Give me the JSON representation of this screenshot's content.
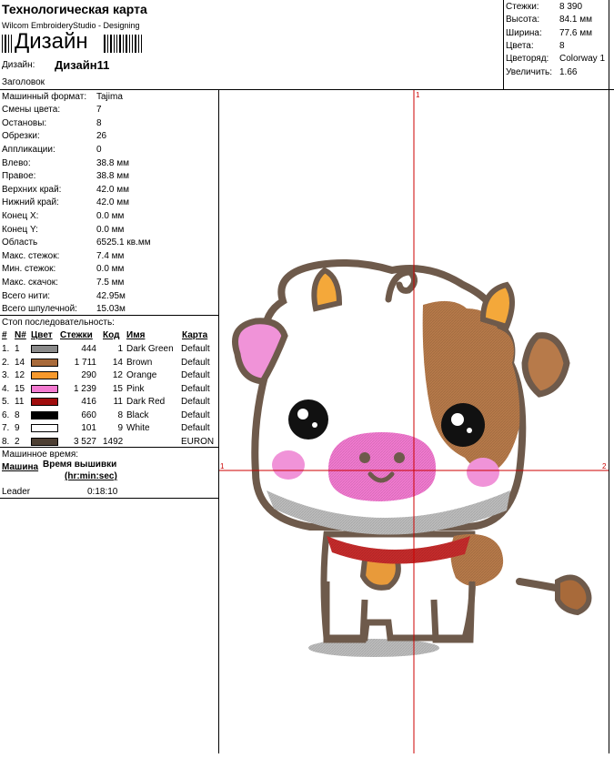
{
  "header": {
    "title": "Технологическая карта",
    "subtitle": "Wilcom EmbroideryStudio - Designing",
    "barcode_text": "Дизайн",
    "design_label": "Дизайн:",
    "design_name": "Дизайн11",
    "heading_label": "Заголовок"
  },
  "summary": [
    {
      "label": "Стежки:",
      "value": "8 390"
    },
    {
      "label": "Высота:",
      "value": "84.1 мм"
    },
    {
      "label": "Ширина:",
      "value": "77.6 мм"
    },
    {
      "label": "Цвета:",
      "value": "8"
    },
    {
      "label": "Цветоряд:",
      "value": "Colorway 1"
    },
    {
      "label": "Увеличить:",
      "value": "1.66"
    }
  ],
  "machine_info": [
    {
      "label": "Машинный формат:",
      "value": "Tajima"
    },
    {
      "label": "Смены цвета:",
      "value": "7"
    },
    {
      "label": "Остановы:",
      "value": "8"
    },
    {
      "label": "Обрезки:",
      "value": "26"
    },
    {
      "label": "Аппликации:",
      "value": "0"
    },
    {
      "label": "Влево:",
      "value": "38.8 мм"
    },
    {
      "label": "Правое:",
      "value": "38.8 мм"
    },
    {
      "label": "Верхних край:",
      "value": "42.0 мм"
    },
    {
      "label": "Нижний край:",
      "value": "42.0 мм"
    },
    {
      "label": "Конец X:",
      "value": "0.0 мм"
    },
    {
      "label": "Конец Y:",
      "value": "0.0 мм"
    },
    {
      "label": "Область",
      "value": "6525.1 кв.мм"
    },
    {
      "label": "Макс. стежок:",
      "value": "7.4 мм"
    },
    {
      "label": "Мин. стежок:",
      "value": "0.0 мм"
    },
    {
      "label": "Макс. скачок:",
      "value": "7.5 мм"
    },
    {
      "label": "Всего нити:",
      "value": "42.95м"
    },
    {
      "label": "Всего шпулечной:",
      "value": "15.03м"
    }
  ],
  "sequence": {
    "title": "Стоп последовательность:",
    "headers": {
      "num": "#",
      "n": "N#",
      "color": "Цвет",
      "stitches": "Стежки",
      "code": "Код",
      "name": "Имя",
      "chart": "Карта"
    },
    "rows": [
      {
        "num": "1.",
        "n": "1",
        "color": "#8a8a8a",
        "stitches": "444",
        "code": "1",
        "name": "Dark Green",
        "chart": "Default"
      },
      {
        "num": "2.",
        "n": "14",
        "color": "#a86a3a",
        "stitches": "1 711",
        "code": "14",
        "name": "Brown",
        "chart": "Default"
      },
      {
        "num": "3.",
        "n": "12",
        "color": "#f7992c",
        "stitches": "290",
        "code": "12",
        "name": "Orange",
        "chart": "Default"
      },
      {
        "num": "4.",
        "n": "15",
        "color": "#f27ad0",
        "stitches": "1 239",
        "code": "15",
        "name": "Pink",
        "chart": "Default"
      },
      {
        "num": "5.",
        "n": "11",
        "color": "#a00d0d",
        "stitches": "416",
        "code": "11",
        "name": "Dark Red",
        "chart": "Default"
      },
      {
        "num": "6.",
        "n": "8",
        "color": "#000000",
        "stitches": "660",
        "code": "8",
        "name": "Black",
        "chart": "Default"
      },
      {
        "num": "7.",
        "n": "9",
        "color": "#ffffff",
        "stitches": "101",
        "code": "9",
        "name": "White",
        "chart": "Default"
      },
      {
        "num": "8.",
        "n": "2",
        "color": "#4d3f33",
        "stitches": "3 527",
        "code": "1492",
        "name": "",
        "chart": "EURON"
      }
    ]
  },
  "machine_time": {
    "title": "Машинное время:",
    "col_machine": "Машина",
    "col_time": "Время вышивки",
    "col_time_unit": "(hr:min:sec)",
    "row_machine": "Leader",
    "row_time": "0:18:10"
  },
  "canvas": {
    "marker_top": "1",
    "marker_left": "1",
    "marker_right": "2",
    "crosshair_color": "#cc0000"
  }
}
